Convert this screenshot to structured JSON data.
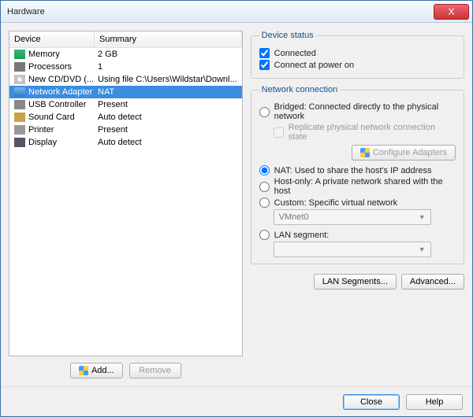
{
  "window": {
    "title": "Hardware",
    "close_x": "X"
  },
  "list": {
    "hdr_device": "Device",
    "hdr_summary": "Summary",
    "rows": [
      {
        "icon": "ic-mem",
        "device": "Memory",
        "summary": "2 GB",
        "sel": false
      },
      {
        "icon": "ic-cpu",
        "device": "Processors",
        "summary": "1",
        "sel": false
      },
      {
        "icon": "ic-cd",
        "device": "New CD/DVD (...",
        "summary": "Using file C:\\Users\\Wildstar\\Downl...",
        "sel": false
      },
      {
        "icon": "ic-net",
        "device": "Network Adapter",
        "summary": "NAT",
        "sel": true
      },
      {
        "icon": "ic-usb",
        "device": "USB Controller",
        "summary": "Present",
        "sel": false
      },
      {
        "icon": "ic-snd",
        "device": "Sound Card",
        "summary": "Auto detect",
        "sel": false
      },
      {
        "icon": "ic-prn",
        "device": "Printer",
        "summary": "Present",
        "sel": false
      },
      {
        "icon": "ic-dsp",
        "device": "Display",
        "summary": "Auto detect",
        "sel": false
      }
    ]
  },
  "left_buttons": {
    "add": "Add...",
    "remove": "Remove"
  },
  "status": {
    "legend": "Device status",
    "connected": "Connected",
    "power_on": "Connect at power on"
  },
  "net": {
    "legend": "Network connection",
    "bridged": "Bridged: Connected directly to the physical network",
    "replicate": "Replicate physical network connection state",
    "configure": "Configure Adapters",
    "nat": "NAT: Used to share the host's IP address",
    "hostonly": "Host-only: A private network shared with the host",
    "custom": "Custom: Specific virtual network",
    "vmnet": "VMnet0",
    "lan": "LAN segment:",
    "lan_val": ""
  },
  "right_buttons": {
    "lanseg": "LAN Segments...",
    "advanced": "Advanced..."
  },
  "footer": {
    "close": "Close",
    "help": "Help"
  }
}
